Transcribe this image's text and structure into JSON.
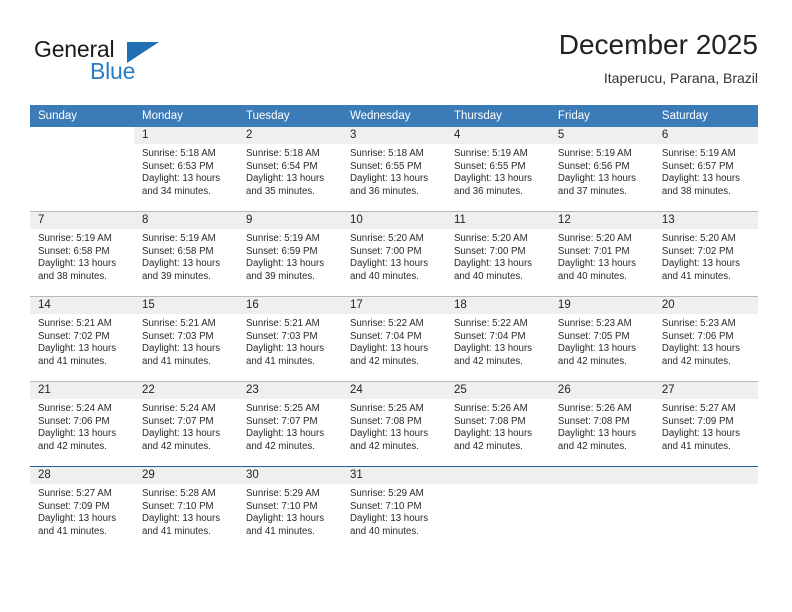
{
  "brand": {
    "word_one": "General",
    "word_two": "Blue",
    "triangle_icon": "triangle-icon",
    "color_dark": "#1a1a1a",
    "color_blue": "#2b7cc4"
  },
  "header": {
    "title": "December 2025",
    "subtitle": "Itaperucu, Parana, Brazil"
  },
  "theme": {
    "header_blue": "#3b7cb8",
    "daynum_band": "#efefef",
    "row_divider": "#b9b9b9",
    "last_divider": "#1f5fa0"
  },
  "weekday_headers": [
    "Sunday",
    "Monday",
    "Tuesday",
    "Wednesday",
    "Thursday",
    "Friday",
    "Saturday"
  ],
  "weeks": [
    [
      {
        "day": "",
        "blank": true,
        "sunrise": "",
        "sunset": "",
        "daylight_line1": "",
        "daylight_line2": ""
      },
      {
        "day": "1",
        "sunrise": "Sunrise: 5:18 AM",
        "sunset": "Sunset: 6:53 PM",
        "daylight_line1": "Daylight: 13 hours",
        "daylight_line2": "and 34 minutes."
      },
      {
        "day": "2",
        "sunrise": "Sunrise: 5:18 AM",
        "sunset": "Sunset: 6:54 PM",
        "daylight_line1": "Daylight: 13 hours",
        "daylight_line2": "and 35 minutes."
      },
      {
        "day": "3",
        "sunrise": "Sunrise: 5:18 AM",
        "sunset": "Sunset: 6:55 PM",
        "daylight_line1": "Daylight: 13 hours",
        "daylight_line2": "and 36 minutes."
      },
      {
        "day": "4",
        "sunrise": "Sunrise: 5:19 AM",
        "sunset": "Sunset: 6:55 PM",
        "daylight_line1": "Daylight: 13 hours",
        "daylight_line2": "and 36 minutes."
      },
      {
        "day": "5",
        "sunrise": "Sunrise: 5:19 AM",
        "sunset": "Sunset: 6:56 PM",
        "daylight_line1": "Daylight: 13 hours",
        "daylight_line2": "and 37 minutes."
      },
      {
        "day": "6",
        "sunrise": "Sunrise: 5:19 AM",
        "sunset": "Sunset: 6:57 PM",
        "daylight_line1": "Daylight: 13 hours",
        "daylight_line2": "and 38 minutes."
      }
    ],
    [
      {
        "day": "7",
        "sunrise": "Sunrise: 5:19 AM",
        "sunset": "Sunset: 6:58 PM",
        "daylight_line1": "Daylight: 13 hours",
        "daylight_line2": "and 38 minutes."
      },
      {
        "day": "8",
        "sunrise": "Sunrise: 5:19 AM",
        "sunset": "Sunset: 6:58 PM",
        "daylight_line1": "Daylight: 13 hours",
        "daylight_line2": "and 39 minutes."
      },
      {
        "day": "9",
        "sunrise": "Sunrise: 5:19 AM",
        "sunset": "Sunset: 6:59 PM",
        "daylight_line1": "Daylight: 13 hours",
        "daylight_line2": "and 39 minutes."
      },
      {
        "day": "10",
        "sunrise": "Sunrise: 5:20 AM",
        "sunset": "Sunset: 7:00 PM",
        "daylight_line1": "Daylight: 13 hours",
        "daylight_line2": "and 40 minutes."
      },
      {
        "day": "11",
        "sunrise": "Sunrise: 5:20 AM",
        "sunset": "Sunset: 7:00 PM",
        "daylight_line1": "Daylight: 13 hours",
        "daylight_line2": "and 40 minutes."
      },
      {
        "day": "12",
        "sunrise": "Sunrise: 5:20 AM",
        "sunset": "Sunset: 7:01 PM",
        "daylight_line1": "Daylight: 13 hours",
        "daylight_line2": "and 40 minutes."
      },
      {
        "day": "13",
        "sunrise": "Sunrise: 5:20 AM",
        "sunset": "Sunset: 7:02 PM",
        "daylight_line1": "Daylight: 13 hours",
        "daylight_line2": "and 41 minutes."
      }
    ],
    [
      {
        "day": "14",
        "sunrise": "Sunrise: 5:21 AM",
        "sunset": "Sunset: 7:02 PM",
        "daylight_line1": "Daylight: 13 hours",
        "daylight_line2": "and 41 minutes."
      },
      {
        "day": "15",
        "sunrise": "Sunrise: 5:21 AM",
        "sunset": "Sunset: 7:03 PM",
        "daylight_line1": "Daylight: 13 hours",
        "daylight_line2": "and 41 minutes."
      },
      {
        "day": "16",
        "sunrise": "Sunrise: 5:21 AM",
        "sunset": "Sunset: 7:03 PM",
        "daylight_line1": "Daylight: 13 hours",
        "daylight_line2": "and 41 minutes."
      },
      {
        "day": "17",
        "sunrise": "Sunrise: 5:22 AM",
        "sunset": "Sunset: 7:04 PM",
        "daylight_line1": "Daylight: 13 hours",
        "daylight_line2": "and 42 minutes."
      },
      {
        "day": "18",
        "sunrise": "Sunrise: 5:22 AM",
        "sunset": "Sunset: 7:04 PM",
        "daylight_line1": "Daylight: 13 hours",
        "daylight_line2": "and 42 minutes."
      },
      {
        "day": "19",
        "sunrise": "Sunrise: 5:23 AM",
        "sunset": "Sunset: 7:05 PM",
        "daylight_line1": "Daylight: 13 hours",
        "daylight_line2": "and 42 minutes."
      },
      {
        "day": "20",
        "sunrise": "Sunrise: 5:23 AM",
        "sunset": "Sunset: 7:06 PM",
        "daylight_line1": "Daylight: 13 hours",
        "daylight_line2": "and 42 minutes."
      }
    ],
    [
      {
        "day": "21",
        "sunrise": "Sunrise: 5:24 AM",
        "sunset": "Sunset: 7:06 PM",
        "daylight_line1": "Daylight: 13 hours",
        "daylight_line2": "and 42 minutes."
      },
      {
        "day": "22",
        "sunrise": "Sunrise: 5:24 AM",
        "sunset": "Sunset: 7:07 PM",
        "daylight_line1": "Daylight: 13 hours",
        "daylight_line2": "and 42 minutes."
      },
      {
        "day": "23",
        "sunrise": "Sunrise: 5:25 AM",
        "sunset": "Sunset: 7:07 PM",
        "daylight_line1": "Daylight: 13 hours",
        "daylight_line2": "and 42 minutes."
      },
      {
        "day": "24",
        "sunrise": "Sunrise: 5:25 AM",
        "sunset": "Sunset: 7:08 PM",
        "daylight_line1": "Daylight: 13 hours",
        "daylight_line2": "and 42 minutes."
      },
      {
        "day": "25",
        "sunrise": "Sunrise: 5:26 AM",
        "sunset": "Sunset: 7:08 PM",
        "daylight_line1": "Daylight: 13 hours",
        "daylight_line2": "and 42 minutes."
      },
      {
        "day": "26",
        "sunrise": "Sunrise: 5:26 AM",
        "sunset": "Sunset: 7:08 PM",
        "daylight_line1": "Daylight: 13 hours",
        "daylight_line2": "and 42 minutes."
      },
      {
        "day": "27",
        "sunrise": "Sunrise: 5:27 AM",
        "sunset": "Sunset: 7:09 PM",
        "daylight_line1": "Daylight: 13 hours",
        "daylight_line2": "and 41 minutes."
      }
    ],
    [
      {
        "day": "28",
        "sunrise": "Sunrise: 5:27 AM",
        "sunset": "Sunset: 7:09 PM",
        "daylight_line1": "Daylight: 13 hours",
        "daylight_line2": "and 41 minutes."
      },
      {
        "day": "29",
        "sunrise": "Sunrise: 5:28 AM",
        "sunset": "Sunset: 7:10 PM",
        "daylight_line1": "Daylight: 13 hours",
        "daylight_line2": "and 41 minutes."
      },
      {
        "day": "30",
        "sunrise": "Sunrise: 5:29 AM",
        "sunset": "Sunset: 7:10 PM",
        "daylight_line1": "Daylight: 13 hours",
        "daylight_line2": "and 41 minutes."
      },
      {
        "day": "31",
        "sunrise": "Sunrise: 5:29 AM",
        "sunset": "Sunset: 7:10 PM",
        "daylight_line1": "Daylight: 13 hours",
        "daylight_line2": "and 40 minutes."
      },
      {
        "day": "",
        "empty": true,
        "sunrise": "",
        "sunset": "",
        "daylight_line1": "",
        "daylight_line2": ""
      },
      {
        "day": "",
        "empty": true,
        "sunrise": "",
        "sunset": "",
        "daylight_line1": "",
        "daylight_line2": ""
      },
      {
        "day": "",
        "empty": true,
        "sunrise": "",
        "sunset": "",
        "daylight_line1": "",
        "daylight_line2": ""
      }
    ]
  ]
}
